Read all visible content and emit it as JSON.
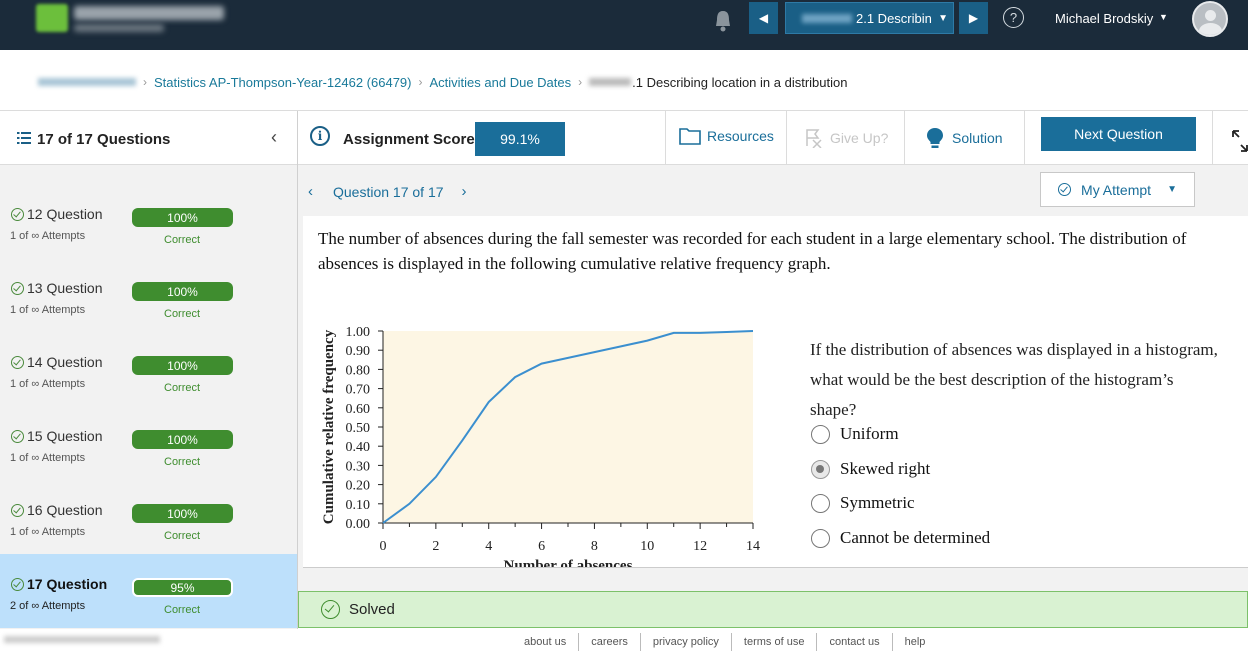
{
  "header": {
    "assignment_select": "2.1 Describin",
    "user_name": "Michael Brodskiy",
    "help": "?"
  },
  "breadcrumb": {
    "course": "Statistics AP-Thompson-Year-12462 (66479)",
    "activities": "Activities and Due Dates",
    "current": ".1 Describing location in a distribution"
  },
  "sidebar": {
    "title": "17 of 17 Questions",
    "items": [
      {
        "label": "12 Question",
        "attempts": "1 of ∞ Attempts",
        "score": "100%",
        "status": "Correct"
      },
      {
        "label": "13 Question",
        "attempts": "1 of ∞ Attempts",
        "score": "100%",
        "status": "Correct"
      },
      {
        "label": "14 Question",
        "attempts": "1 of ∞ Attempts",
        "score": "100%",
        "status": "Correct"
      },
      {
        "label": "15 Question",
        "attempts": "1 of ∞ Attempts",
        "score": "100%",
        "status": "Correct"
      },
      {
        "label": "16 Question",
        "attempts": "1 of ∞ Attempts",
        "score": "100%",
        "status": "Correct"
      },
      {
        "label": "17 Question",
        "attempts": "2 of ∞ Attempts",
        "score": "95%",
        "status": "Correct"
      }
    ]
  },
  "toolbar": {
    "score_label": "Assignment Score:",
    "score_value": "99.1%",
    "resources": "Resources",
    "give_up": "Give Up?",
    "solution": "Solution",
    "next_question": "Next Question"
  },
  "question": {
    "nav_label": "Question 17 of 17",
    "my_attempt": "My Attempt",
    "text": "The number of absences during the fall semester was recorded for each student in a large elementary school. The distribution of absences is displayed in the following cumulative relative frequency graph.",
    "prompt": "If the distribution of absences was displayed in a histogram, what would be the best description of the histogram’s shape?",
    "options": [
      "Uniform",
      "Skewed right",
      "Symmetric",
      "Cannot be determined"
    ],
    "selected": "Skewed right"
  },
  "chart_data": {
    "type": "line",
    "xlabel": "Number of absences",
    "ylabel": "Cumulative relative frequency",
    "x_ticks": [
      "0",
      "2",
      "4",
      "6",
      "8",
      "10",
      "12",
      "14"
    ],
    "y_ticks": [
      "0.00",
      "0.10",
      "0.20",
      "0.30",
      "0.40",
      "0.50",
      "0.60",
      "0.70",
      "0.80",
      "0.90",
      "1.00"
    ],
    "xlim": [
      0,
      14
    ],
    "ylim": [
      0,
      1
    ],
    "x": [
      0,
      1,
      2,
      3,
      4,
      5,
      6,
      7,
      8,
      9,
      10,
      11,
      12,
      13,
      14
    ],
    "y": [
      0.0,
      0.1,
      0.24,
      0.43,
      0.63,
      0.76,
      0.83,
      0.86,
      0.89,
      0.92,
      0.95,
      0.99,
      0.99,
      0.995,
      1.0
    ],
    "series_color": "#3b8fcf",
    "plot_background": "#fdf6e4"
  },
  "solved": {
    "label": "Solved"
  },
  "footer": {
    "links": [
      "about us",
      "careers",
      "privacy policy",
      "terms of use",
      "contact us",
      "help"
    ]
  }
}
